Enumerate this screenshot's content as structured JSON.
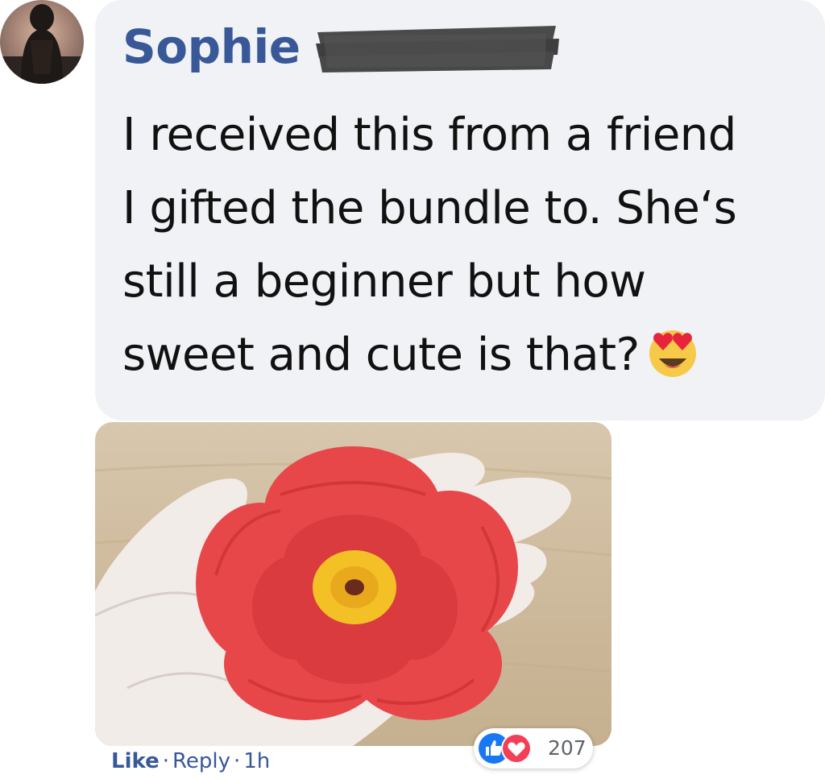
{
  "comment": {
    "author": "Sophie",
    "text_lines": [
      "I received this from a friend",
      "I gifted the bundle to. She‘s",
      "still a beginner but how",
      "sweet and cute is that?"
    ],
    "emoji": "heart-eyes-emoji"
  },
  "photo": {
    "subject": "red-crochet-flower-in-hand"
  },
  "reactions": {
    "icons": [
      "like-icon",
      "love-icon"
    ],
    "count": "207"
  },
  "actions": {
    "like_label": "Like",
    "separator": "·",
    "reply_label": "Reply",
    "time": "1h"
  },
  "colors": {
    "name_blue": "#385898",
    "bubble_bg": "#f0f2f5",
    "like_blue": "#1877f2",
    "love_red": "#f33e58"
  }
}
